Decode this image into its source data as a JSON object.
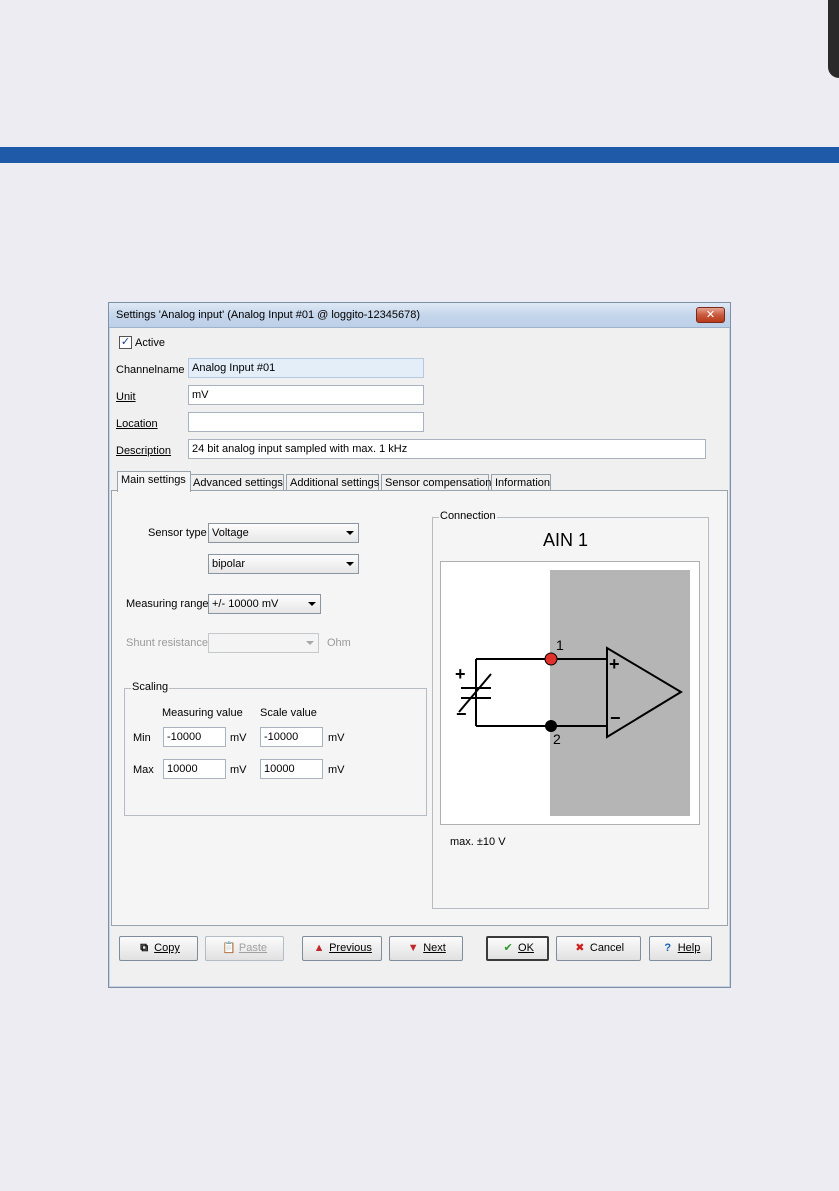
{
  "dialog": {
    "title": "Settings 'Analog input' (Analog Input #01 @ loggito-12345678)",
    "close_glyph": "✕"
  },
  "general": {
    "active_label": "Active",
    "active_checked": true,
    "channelname_label": "Channelname",
    "channelname_value": "Analog Input #01",
    "unit_label": "Unit",
    "unit_value": "mV",
    "location_label": "Location",
    "location_value": "",
    "description_label": "Description",
    "description_value": "24 bit analog input sampled with max. 1 kHz"
  },
  "tabs": [
    {
      "label": "Main settings",
      "active": true
    },
    {
      "label": "Advanced settings"
    },
    {
      "label": "Additional settings"
    },
    {
      "label": "Sensor compensation"
    },
    {
      "label": "Information"
    }
  ],
  "main": {
    "sensor_type_label": "Sensor type",
    "sensor_type_value": "Voltage",
    "polarity_value": "bipolar",
    "measuring_range_label": "Measuring range",
    "measuring_range_value": "+/- 10000 mV",
    "shunt_label": "Shunt resistance",
    "shunt_value": "",
    "shunt_unit": "Ohm"
  },
  "scaling": {
    "title": "Scaling",
    "measuring_header": "Measuring value",
    "scale_header": "Scale value",
    "min_label": "Min",
    "max_label": "Max",
    "min_measuring": "-10000",
    "min_measuring_unit": "mV",
    "min_scale": "-10000",
    "min_scale_unit": "mV",
    "max_measuring": "10000",
    "max_measuring_unit": "mV",
    "max_scale": "10000",
    "max_scale_unit": "mV"
  },
  "connection": {
    "group_label": "Connection",
    "title": "AIN 1",
    "pin1": "1",
    "pin2": "2",
    "plus": "+",
    "minus": "−",
    "amp_plus": "+",
    "amp_minus": "−",
    "note": "max. ±10 V"
  },
  "buttons": {
    "copy": "Copy",
    "paste": "Paste",
    "previous": "Previous",
    "next": "Next",
    "ok": "OK",
    "cancel": "Cancel",
    "help": "Help"
  },
  "colors": {
    "accent_band": "#1f5aa8",
    "pin1": "#e0322a",
    "panel_grey": "#b5b5b5"
  }
}
